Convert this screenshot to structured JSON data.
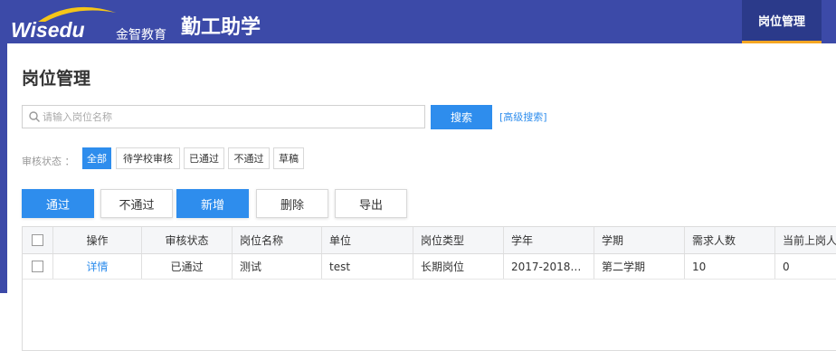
{
  "header": {
    "logo_text": "Wisedu",
    "logo_cn": "金智教育",
    "app_title": "勤工助学",
    "active_tab": "岗位管理"
  },
  "page": {
    "title": "岗位管理"
  },
  "search": {
    "placeholder": "请输入岗位名称",
    "value": "",
    "button_label": "搜索",
    "advanced_link": "[高级搜索]"
  },
  "filter": {
    "label": "审核状态 ：",
    "options": [
      "全部",
      "待学校审核",
      "已通过",
      "不通过",
      "草稿"
    ],
    "selected": "全部"
  },
  "actions": {
    "approve": "通过",
    "reject": "不通过",
    "add": "新增",
    "delete": "删除",
    "export": "导出"
  },
  "table": {
    "columns": [
      "操作",
      "审核状态",
      "岗位名称",
      "单位",
      "岗位类型",
      "学年",
      "学期",
      "需求人数",
      "当前上岗人"
    ],
    "rows": [
      {
        "action": "详情",
        "status": "已通过",
        "name": "测试",
        "unit": "test",
        "type": "长期岗位",
        "year": "2017-2018…",
        "term": "第二学期",
        "required": "10",
        "current": "0"
      }
    ]
  },
  "colors": {
    "header_bg": "#3c4aa8",
    "accent": "#2e8ded",
    "tab_underline": "#f5a623"
  }
}
